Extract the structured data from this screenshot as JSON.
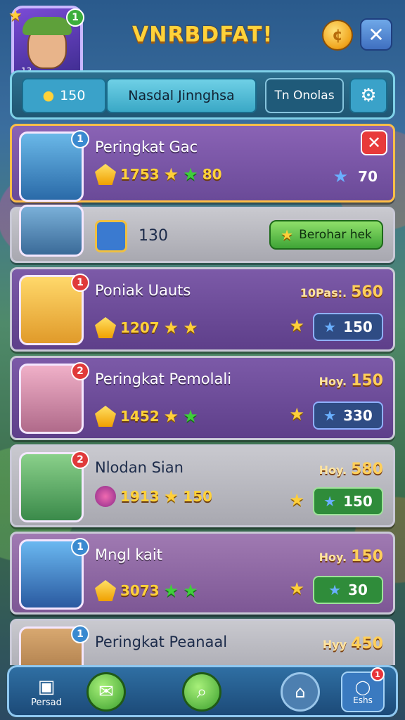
{
  "header": {
    "title": "VNRBDFAT!",
    "level": "1",
    "avatar_level_text": "13",
    "coins_value": "150",
    "player_name": "Nasdal Jinnghsa",
    "tab_label": "Tn Onolas"
  },
  "list": [
    {
      "name": "Peringkat Gac",
      "score": "1753",
      "stars_value": "80",
      "right_value": "70",
      "badge": "1"
    },
    {
      "name": "",
      "count": "130",
      "button_label": "Berohar hek"
    },
    {
      "name": "Poniak Uauts",
      "score": "1207",
      "hov_label": "10Pas:.",
      "hov_value": "560",
      "right_value": "150",
      "badge": "1"
    },
    {
      "name": "Peringkat Pemolali",
      "score": "1452",
      "hov_label": "Hoy.",
      "hov_value": "150",
      "right_value": "330",
      "badge": "2"
    },
    {
      "name": "Nlodan Sian",
      "score": "1913",
      "extra_value": "150",
      "hov_label": "Hoy.",
      "hov_value": "580",
      "right_value": "150",
      "badge": "2"
    },
    {
      "name": "Mngl kait",
      "score": "3073",
      "hov_label": "Hoy.",
      "hov_value": "150",
      "right_value": "30",
      "badge": "1"
    },
    {
      "name": "Peringkat Peanaal",
      "hov_label": "Hyy",
      "hov_value": "450",
      "badge": "1"
    }
  ],
  "nav": {
    "left_label": "Persad",
    "right_label": "Eshs",
    "right_badge": "1"
  },
  "colors": {
    "accent": "#ffd23a",
    "panel": "#2d6f8e",
    "green": "#3ea436",
    "red": "#e83a3a"
  }
}
